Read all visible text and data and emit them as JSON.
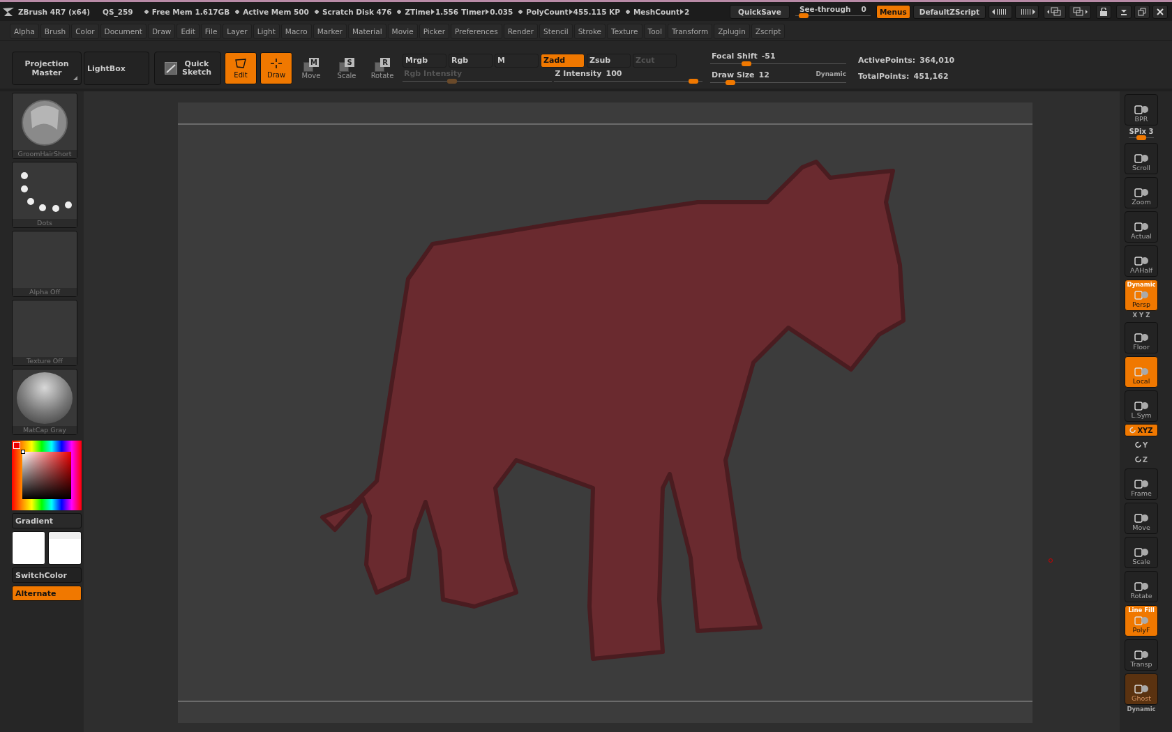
{
  "title_bar": {
    "app": "ZBrush 4R7 (x64)",
    "file": "QS_259",
    "stats": [
      {
        "label": "Free Mem 1.617GB",
        "bullet": true
      },
      {
        "label": "Active Mem 500",
        "bullet": true
      },
      {
        "label": "Scratch Disk 476",
        "bullet": true
      },
      {
        "label": "ZTime",
        "value": "1.556",
        "bullet": true
      },
      {
        "label": "Timer",
        "value": "0.035",
        "bullet": false
      },
      {
        "label": "PolyCount",
        "value": "455.115 KP",
        "bullet": true
      },
      {
        "label": "MeshCount",
        "value": "2",
        "bullet": true
      }
    ],
    "quicksave": "QuickSave",
    "see_through": {
      "label": "See-through",
      "value": "0",
      "level": 0.05
    },
    "buttons": [
      {
        "label": "Menus",
        "on": true
      },
      {
        "label": "DefaultZScript",
        "on": false
      }
    ]
  },
  "menu_bar": [
    "Alpha",
    "Brush",
    "Color",
    "Document",
    "Draw",
    "Edit",
    "File",
    "Layer",
    "Light",
    "Macro",
    "Marker",
    "Material",
    "Movie",
    "Picker",
    "Preferences",
    "Render",
    "Stencil",
    "Stroke",
    "Texture",
    "Tool",
    "Transform",
    "Zplugin",
    "Zscript"
  ],
  "toolbar": {
    "buttons": [
      {
        "label": "Projection Master",
        "kind": "menu"
      },
      {
        "label": "LightBox",
        "kind": "plain"
      },
      {
        "label": "Quick Sketch",
        "kind": "sketch"
      },
      {
        "label": "Edit",
        "kind": "mode",
        "on": true
      },
      {
        "label": "Draw",
        "kind": "mode",
        "on": true
      },
      {
        "label": "Move",
        "kind": "transform",
        "key": "M",
        "on": false
      },
      {
        "label": "Scale",
        "kind": "transform",
        "key": "S",
        "on": false
      },
      {
        "label": "Rotate",
        "kind": "transform",
        "key": "R",
        "on": false
      }
    ],
    "draw_modes": [
      {
        "label": "Mrgb",
        "selected": false,
        "disabled": false
      },
      {
        "label": "Rgb",
        "selected": false,
        "disabled": false
      },
      {
        "label": "M",
        "selected": false,
        "disabled": false
      },
      {
        "label": "Zadd",
        "selected": true,
        "disabled": false
      },
      {
        "label": "Zsub",
        "selected": false,
        "disabled": false
      },
      {
        "label": "Zcut",
        "selected": false,
        "disabled": true
      }
    ],
    "intensity_sliders": [
      {
        "label": "Rgb Intensity",
        "disabled": true,
        "level": 0.32
      },
      {
        "label": "Z Intensity",
        "value": "100",
        "disabled": false,
        "level": 0.97
      }
    ],
    "brush_sliders": [
      {
        "label": "Focal Shift",
        "value": "-51",
        "level": 0.25
      },
      {
        "label": "Draw Size",
        "value": "12",
        "note": "Dynamic",
        "level": 0.12
      }
    ],
    "points": [
      {
        "label": "ActivePoints:",
        "value": "364,010"
      },
      {
        "label": "TotalPoints:",
        "value": "451,162"
      }
    ]
  },
  "left_shelf": {
    "thumbnails": [
      {
        "label": "GroomHairShort",
        "kind": "brush"
      },
      {
        "label": "Dots",
        "kind": "stroke"
      },
      {
        "label": "Alpha Off",
        "kind": "empty"
      },
      {
        "label": "Texture Off",
        "kind": "empty"
      },
      {
        "label": "MatCap Gray",
        "kind": "material"
      }
    ],
    "gradient": {
      "label": "Gradient",
      "on": false
    },
    "switch_color": {
      "label": "SwitchColor",
      "on": false
    },
    "alternate": {
      "label": "Alternate",
      "on": true
    }
  },
  "right_shelf": [
    {
      "kind": "button",
      "label": "BPR",
      "on": false,
      "disabled": false
    },
    {
      "kind": "slider",
      "label": "SPix 3",
      "level": 0.5
    },
    {
      "kind": "button",
      "label": "Scroll",
      "on": false,
      "disabled": false
    },
    {
      "kind": "button",
      "label": "Zoom",
      "on": false,
      "disabled": false
    },
    {
      "kind": "button",
      "label": "Actual",
      "on": false,
      "disabled": false
    },
    {
      "kind": "button",
      "label": "AAHalf",
      "on": false,
      "disabled": false
    },
    {
      "kind": "button",
      "label": "Persp",
      "caption": "Dynamic",
      "on": true,
      "disabled": false
    },
    {
      "kind": "caption",
      "label": "X Y Z"
    },
    {
      "kind": "button",
      "label": "Floor",
      "on": false,
      "disabled": false
    },
    {
      "kind": "button",
      "label": "Local",
      "on": true,
      "disabled": false
    },
    {
      "kind": "button",
      "label": "L.Sym",
      "on": false,
      "disabled": false
    },
    {
      "kind": "small",
      "label": "XYZ",
      "on": true
    },
    {
      "kind": "small",
      "label": "Y",
      "on": false
    },
    {
      "kind": "small",
      "label": "Z",
      "on": false
    },
    {
      "kind": "button",
      "label": "Frame",
      "on": false,
      "disabled": false
    },
    {
      "kind": "button",
      "label": "Move",
      "on": false,
      "disabled": false
    },
    {
      "kind": "button",
      "label": "Scale",
      "on": false,
      "disabled": false
    },
    {
      "kind": "button",
      "label": "Rotate",
      "on": false,
      "disabled": false
    },
    {
      "kind": "button",
      "label": "PolyF",
      "caption": "Line Fill",
      "on": true,
      "disabled": false
    },
    {
      "kind": "button",
      "label": "Transp",
      "on": false,
      "disabled": false
    },
    {
      "kind": "button",
      "label": "Ghost",
      "on": true,
      "disabled": true
    },
    {
      "kind": "caption",
      "label": "Dynamic"
    }
  ]
}
